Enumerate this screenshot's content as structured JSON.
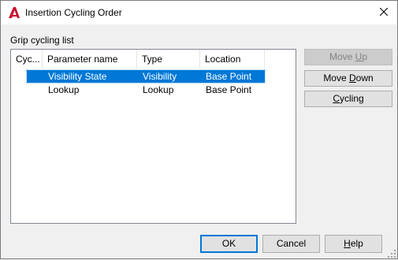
{
  "window": {
    "title": "Insertion Cycling Order",
    "app_icon": "autocad-logo-icon",
    "close_icon": "close-icon"
  },
  "group": {
    "label": "Grip cycling list"
  },
  "list": {
    "columns": [
      "Cyc...",
      "Parameter name",
      "Type",
      "Location"
    ],
    "rows": [
      {
        "name": "Visibility State",
        "type": "Visibility",
        "location": "Base Point",
        "selected": true
      },
      {
        "name": "Lookup",
        "type": "Lookup",
        "location": "Base Point",
        "selected": false
      }
    ]
  },
  "buttons": {
    "move_up": {
      "pre": "Move ",
      "key": "U",
      "post": "p",
      "enabled": false
    },
    "move_down": {
      "pre": "Move ",
      "key": "D",
      "post": "own",
      "enabled": true
    },
    "cycling": {
      "pre": "",
      "key": "C",
      "post": "ycling",
      "enabled": true
    },
    "ok": "OK",
    "cancel": "Cancel",
    "help": {
      "pre": "",
      "key": "H",
      "post": "elp"
    }
  },
  "colors": {
    "selection": "#0078d7",
    "autocad_red": "#c8102e"
  }
}
